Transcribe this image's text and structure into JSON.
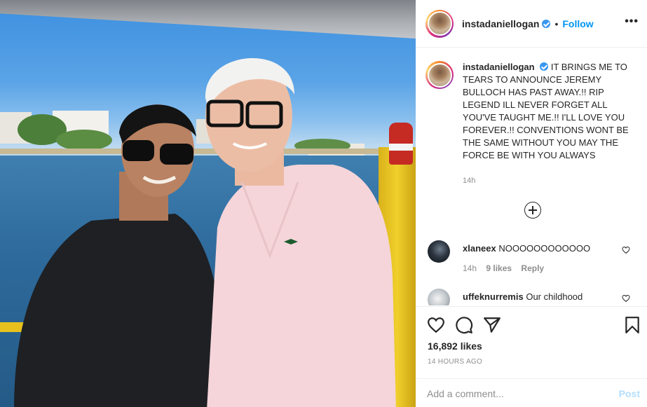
{
  "post": {
    "author": "instadaniellogan",
    "follow_label": "Follow",
    "separator": "•",
    "more_label": "•••",
    "caption": "IT BRINGS ME TO TEARS TO ANNOUNCE JEREMY BULLOCH HAS PAST AWAY.!! RIP LEGEND ILL NEVER FORGET ALL YOU'VE TAUGHT ME.!! I'LL LOVE YOU FOREVER.!! CONVENTIONS WONT BE THE SAME WITHOUT YOU MAY THE FORCE BE WITH YOU ALWAYS",
    "caption_time": "14h",
    "likes": "16,892 likes",
    "timestamp": "14 HOURS AGO"
  },
  "comments": [
    {
      "user": "xlaneex",
      "text": "NOOOOOOOOOOOO",
      "time": "14h",
      "likes": "9 likes",
      "reply": "Reply"
    },
    {
      "user": "uffeknurremis",
      "text": "Our childhood",
      "time": "",
      "likes": "",
      "reply": ""
    }
  ],
  "add_comment": {
    "placeholder": "Add a comment...",
    "post_label": "Post"
  },
  "icons": {
    "verified": "verified-badge-icon",
    "load_more": "plus-circle-icon",
    "like": "heart-icon",
    "comment": "speech-bubble-icon",
    "share": "paper-plane-icon",
    "save": "bookmark-icon"
  },
  "colors": {
    "accent": "#0095f6",
    "verified": "#3897f0",
    "muted": "#8e8e8e",
    "post_disabled": "#b2dffc"
  }
}
